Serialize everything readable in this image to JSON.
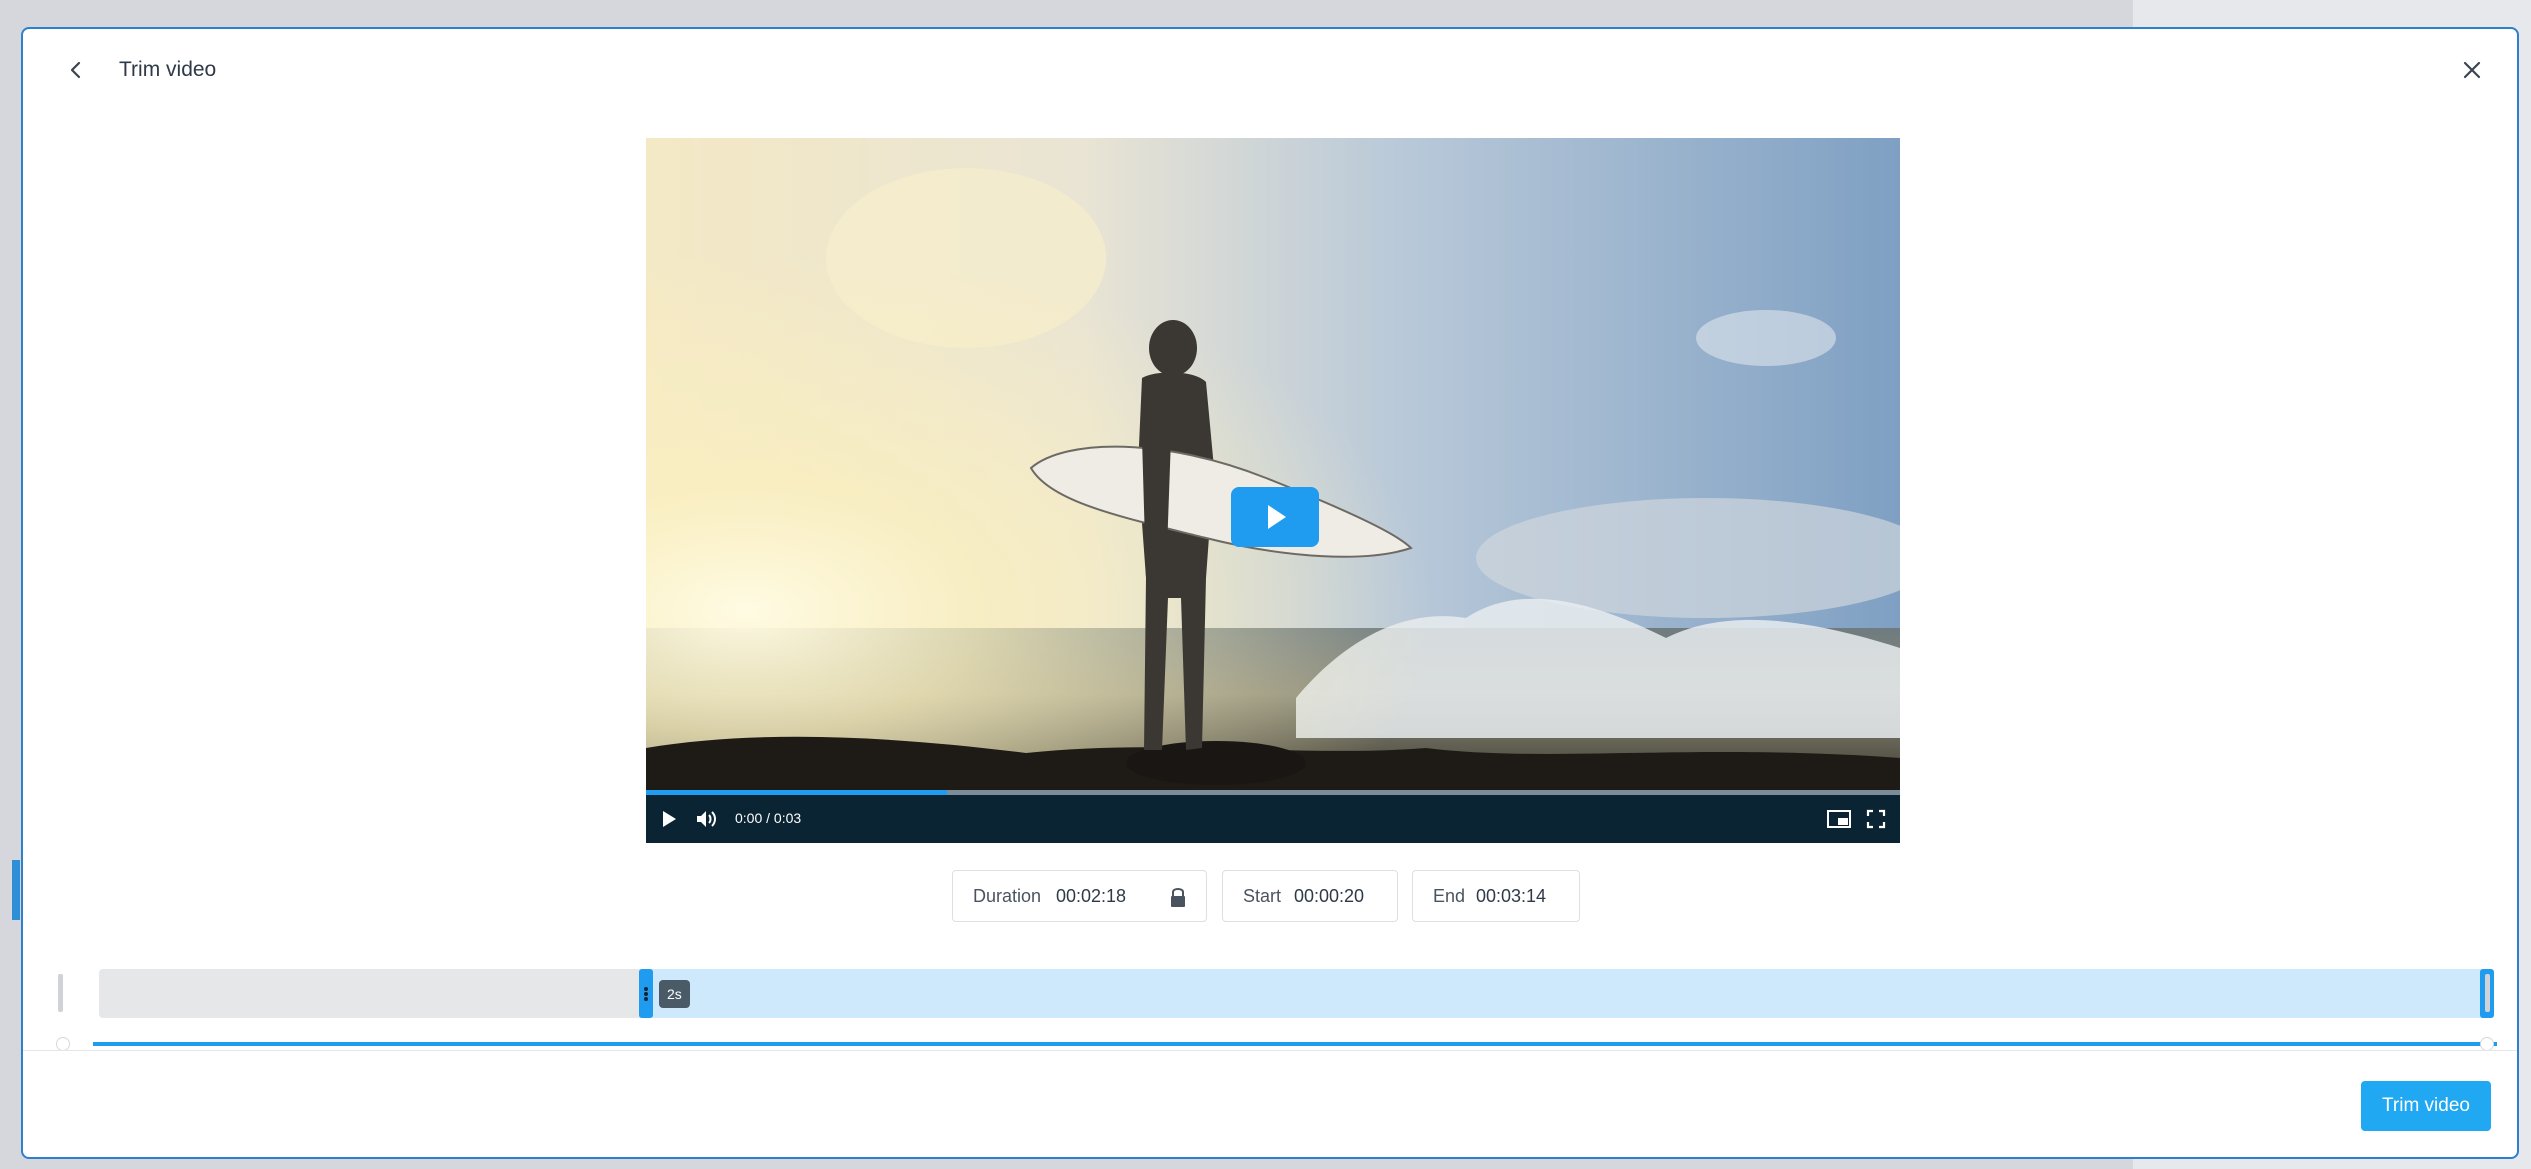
{
  "header": {
    "title": "Trim video"
  },
  "video": {
    "time_display": "0:00 / 0:03",
    "progress_fraction": 0.24
  },
  "fields": {
    "duration_label": "Duration",
    "duration_value": "00:02:18",
    "start_label": "Start",
    "start_value": "00:00:20",
    "end_label": "End",
    "end_value": "00:03:14"
  },
  "timeline": {
    "marker_label": "2s"
  },
  "footer": {
    "trim_button": "Trim video"
  },
  "colors": {
    "accent": "#21a8f2",
    "selection": "#cde9fb",
    "player_bar": "#0b2433"
  }
}
